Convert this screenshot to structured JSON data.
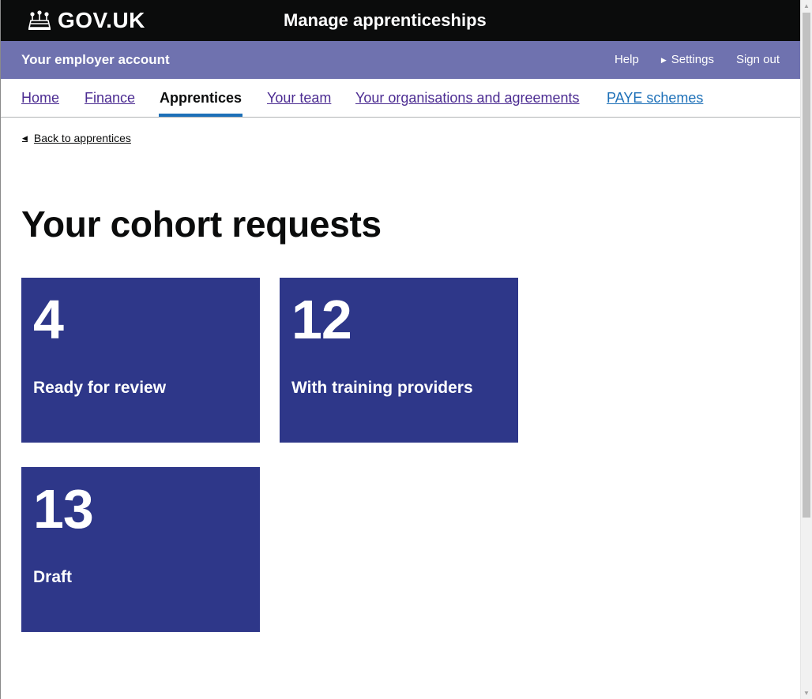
{
  "header": {
    "logo_text": "GOV.UK",
    "crown_icon": "crown-icon",
    "service_name": "Manage apprenticeships"
  },
  "sub_header": {
    "account_name": "Your employer account",
    "help": "Help",
    "settings": "Settings",
    "sign_out": "Sign out"
  },
  "nav": {
    "items": [
      {
        "label": "Home"
      },
      {
        "label": "Finance"
      },
      {
        "label": "Apprentices"
      },
      {
        "label": "Your team"
      },
      {
        "label": "Your organisations and agreements"
      },
      {
        "label": "PAYE schemes"
      }
    ],
    "active": "Apprentices"
  },
  "back_link": "Back to apprentices",
  "page_title": "Your cohort requests",
  "tiles": [
    {
      "count": "4",
      "label": "Ready for review"
    },
    {
      "count": "12",
      "label": "With training providers"
    },
    {
      "count": "13",
      "label": "Draft"
    }
  ],
  "colors": {
    "header_bg": "#0b0c0c",
    "sub_header_bg": "#6f72af",
    "tile_bg": "#2e3789",
    "nav_link": "#4c2c92",
    "active_underline": "#1d70b8"
  }
}
